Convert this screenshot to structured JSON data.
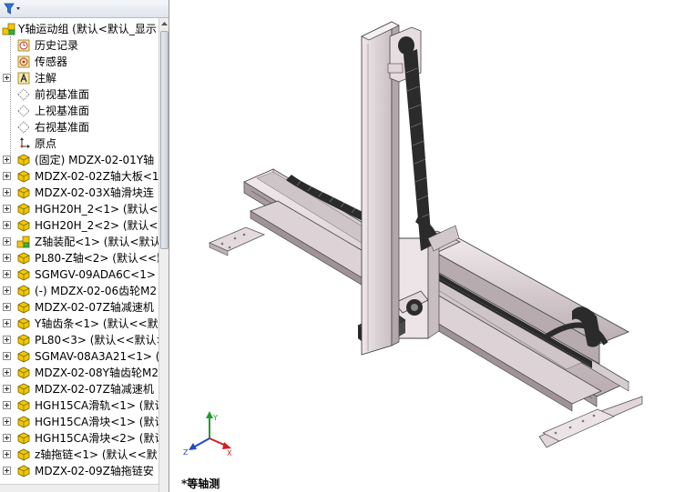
{
  "tree": {
    "root_label": "Y轴运动组 (默认<默认_显示",
    "items": [
      {
        "label": "历史记录",
        "icon": "history-icon"
      },
      {
        "label": "传感器",
        "icon": "sensor-icon"
      },
      {
        "label": "注解",
        "icon": "annotation-icon"
      },
      {
        "label": "前视基准面",
        "icon": "plane-icon"
      },
      {
        "label": "上视基准面",
        "icon": "plane-icon"
      },
      {
        "label": "右视基准面",
        "icon": "plane-icon"
      },
      {
        "label": "原点",
        "icon": "origin-icon"
      },
      {
        "label": "(固定) MDZX-02-01Y轴",
        "icon": "part-icon"
      },
      {
        "label": "MDZX-02-02Z轴大板<1",
        "icon": "part-icon"
      },
      {
        "label": "MDZX-02-03X轴滑块连",
        "icon": "part-icon"
      },
      {
        "label": "HGH20H_2<1> (默认<-",
        "icon": "part-icon"
      },
      {
        "label": "HGH20H_2<2> (默认<-",
        "icon": "part-icon"
      },
      {
        "label": "Z轴装配<1> (默认<默认",
        "icon": "subassembly-icon"
      },
      {
        "label": "PL80-Z轴<2> (默认<<默",
        "icon": "part-icon"
      },
      {
        "label": "SGMGV-09ADA6C<1>",
        "icon": "part-icon"
      },
      {
        "label": "(-) MDZX-02-06齿轮M2",
        "icon": "part-icon"
      },
      {
        "label": "MDZX-02-07Z轴减速机",
        "icon": "part-icon"
      },
      {
        "label": "Y轴齿条<1> (默认<<默",
        "icon": "part-icon"
      },
      {
        "label": "PL80<3> (默认<<默认>",
        "icon": "part-icon"
      },
      {
        "label": "SGMAV-08A3A21<1> (",
        "icon": "part-icon"
      },
      {
        "label": "MDZX-02-08Y轴齿轮M2",
        "icon": "part-icon"
      },
      {
        "label": "MDZX-02-07Z轴减速机",
        "icon": "part-icon"
      },
      {
        "label": "HGH15CA滑轨<1> (默认",
        "icon": "part-icon"
      },
      {
        "label": "HGH15CA滑块<1> (默认",
        "icon": "part-icon"
      },
      {
        "label": "HGH15CA滑块<2> (默认",
        "icon": "part-icon"
      },
      {
        "label": "z轴拖链<1> (默认<<默",
        "icon": "part-icon"
      },
      {
        "label": "MDZX-02-09Z轴拖链安",
        "icon": "part-icon"
      }
    ]
  },
  "viewport": {
    "view_label": "*等轴测",
    "triad": {
      "x": "X",
      "y": "Y",
      "z": "Z"
    }
  },
  "colors": {
    "part_icon": "#f0c800",
    "model_light": "#e7dde0",
    "model_mid": "#bfb3b7",
    "model_dark": "#3a3a3a"
  }
}
